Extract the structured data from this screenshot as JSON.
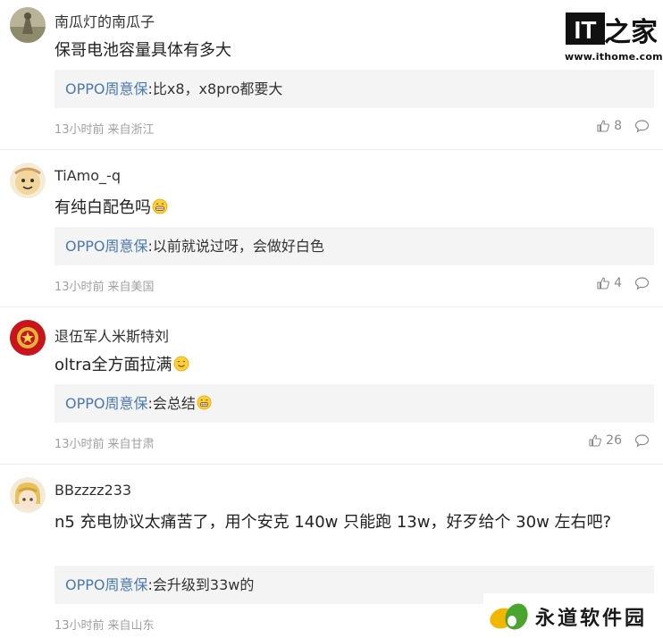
{
  "site": {
    "url": "www.ithome.com",
    "logo_text": "IT之家"
  },
  "watermark": {
    "text": "永道软件园"
  },
  "comments": [
    {
      "user": "南瓜灯的南瓜子",
      "text": "保哥电池容量具体有多大",
      "reply_name": "OPPO周意保",
      "reply_colon": ":",
      "reply_text": "比x8，x8pro都要大",
      "time": "13小时前",
      "location": "来自浙江",
      "likes": "8",
      "avatar": "landscape-avatar"
    },
    {
      "user": "TiAmo_-q",
      "text": "有纯白配色吗",
      "reply_name": "OPPO周意保",
      "reply_colon": ":",
      "reply_text": "以前就说过呀，会做好白色",
      "time": "13小时前",
      "location": "来自美国",
      "likes": "4",
      "avatar": "cartoon-avatar"
    },
    {
      "user": "退伍军人米斯特刘",
      "text": "oltra全方面拉满",
      "reply_name": "OPPO周意保",
      "reply_colon": ":",
      "reply_text": "会总结",
      "time": "13小时前",
      "location": "来自甘肃",
      "likes": "26",
      "avatar": "red-emblem-avatar"
    },
    {
      "user": "BBzzzz233",
      "text": "n5 充电协议太痛苦了，用个安克 140w 只能跑 13w，好歹给个 30w 左右吧?",
      "reply_name": "OPPO周意保",
      "reply_colon": ":",
      "reply_text": "会升级到33w的",
      "time": "13小时前",
      "location": "来自山东",
      "likes": "",
      "avatar": "anime-avatar"
    }
  ]
}
